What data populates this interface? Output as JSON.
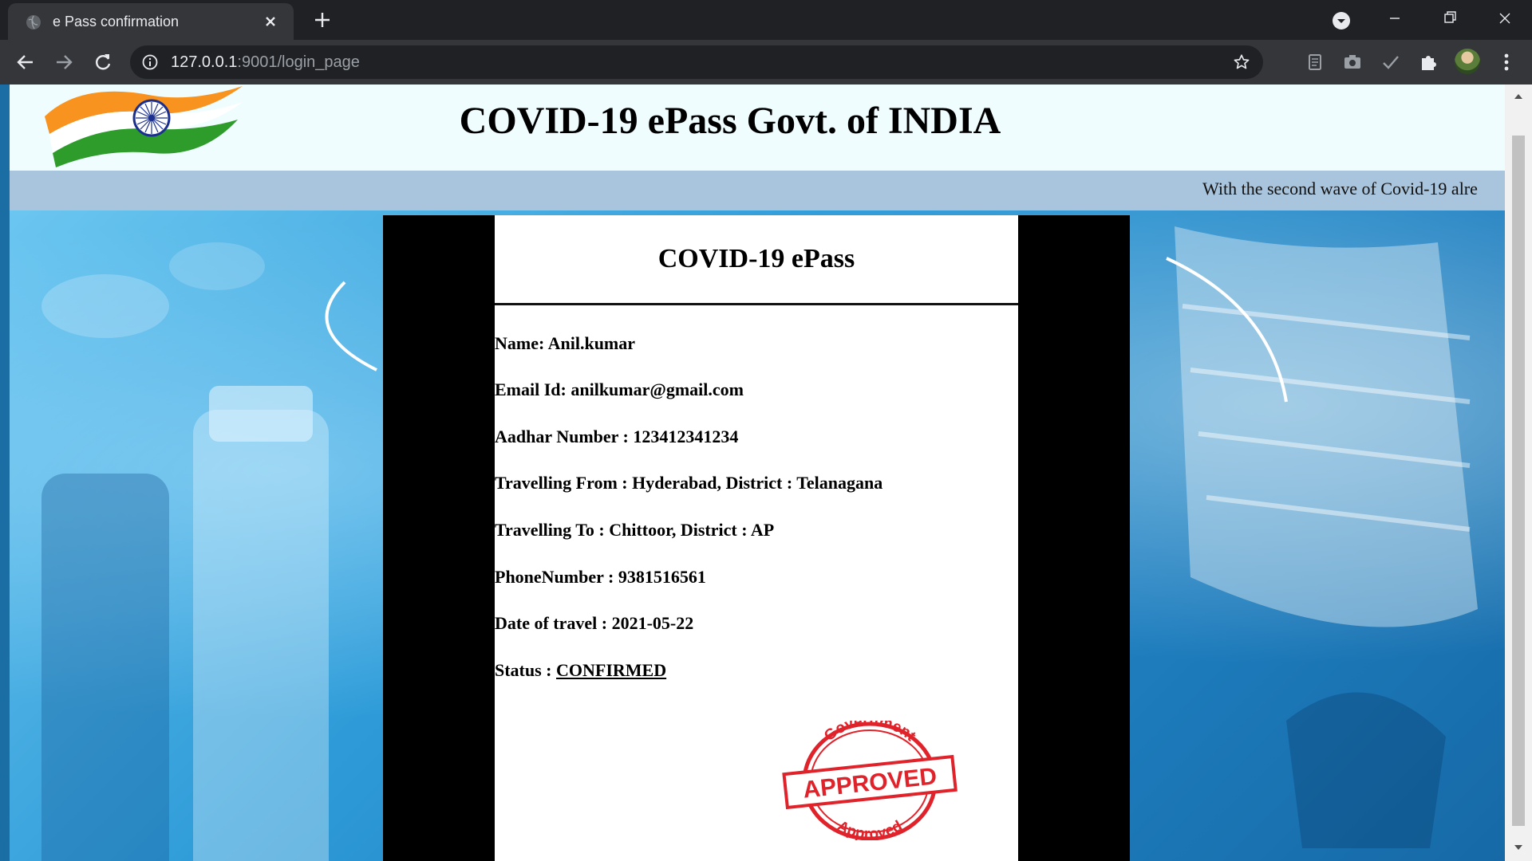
{
  "browser": {
    "tab_title": "e Pass confirmation",
    "url_host": "127.0.0.1",
    "url_rest": ":9001/login_page"
  },
  "page": {
    "header_title": "COVID-19 ePass Govt. of INDIA",
    "marquee_text": "With the second wave of Covid-19 alre"
  },
  "epass": {
    "title": "COVID-19 ePass",
    "fields": [
      {
        "label": "Name:",
        "value": "Anil.kumar"
      },
      {
        "label": "Email Id:",
        "value": "anilkumar@gmail.com"
      },
      {
        "label": "Aadhar Number :",
        "value": "123412341234"
      },
      {
        "label": "Travelling From :",
        "value": "Hyderabad, District : Telanagana"
      },
      {
        "label": "Travelling To :",
        "value": "Chittoor, District : AP"
      },
      {
        "label": "PhoneNumber :",
        "value": "9381516561"
      },
      {
        "label": "Date of travel :",
        "value": "2021-05-22"
      }
    ],
    "status_label": "Status :",
    "status_value": "CONFIRMED",
    "stamp": {
      "top": "Government",
      "middle": "APPROVED",
      "bottom": "Approved"
    }
  },
  "colors": {
    "stamp_red": "#e0232b",
    "header_bg": "#f0fdff",
    "marquee_bg": "#a9c4dd"
  }
}
